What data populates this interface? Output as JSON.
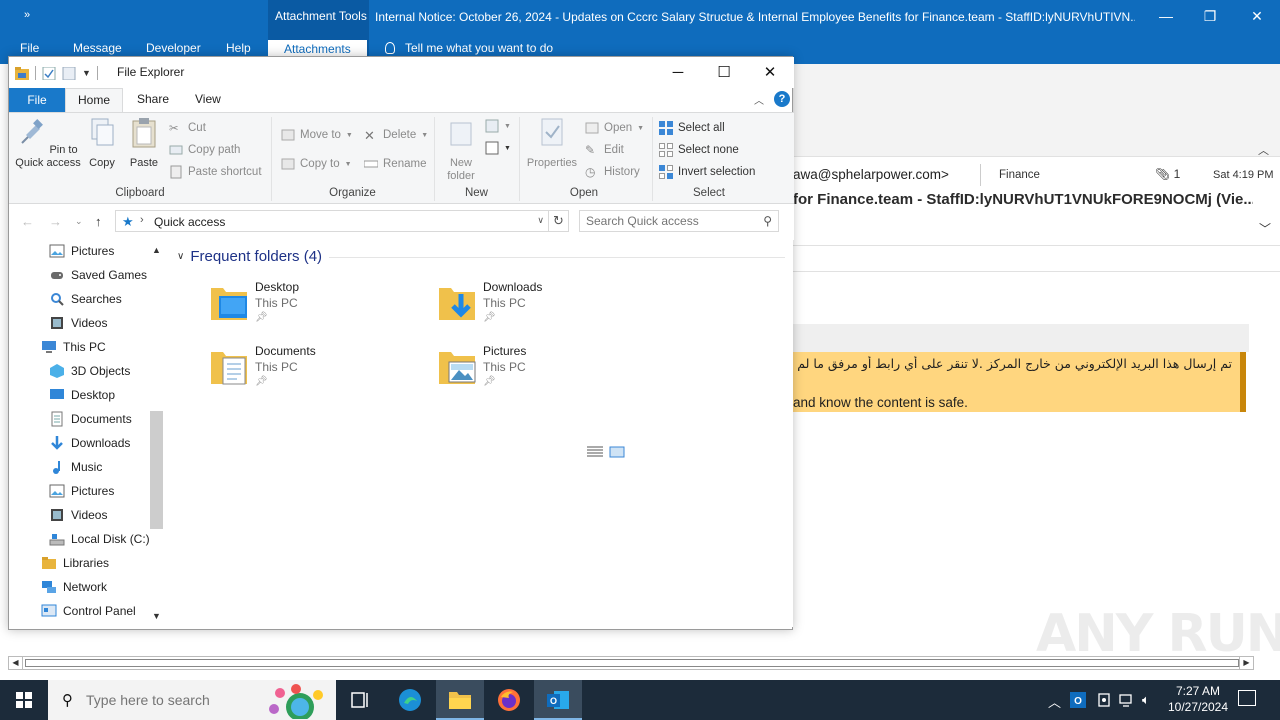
{
  "outlook": {
    "qat_symbol": "»",
    "context_tab_group": "Attachment Tools",
    "title": "Internal Notice: October 26, 2024 - Updates on Cccrc Salary Structue & Internal Employee Benefits for Finance.team - StaffID:lyNURVhUTIVN...",
    "tabs": [
      "File",
      "Message",
      "Developer",
      "Help",
      "Attachments"
    ],
    "tell_me": "Tell me what you want to do",
    "from": "awa@sphelarpower.com>",
    "to": "Finance",
    "attachment_count": "1",
    "date": "Sat 4:19 PM",
    "subject": "for Finance.team - StaffID:lyNURVhUT1VNUkFORE9NOCMj (Vie...",
    "warning_arabic": "تم إرسال هذا البريد الإلكتروني من خارج المركز .لا تنقر على أي رابط أو مرفق ما لم تتأكد من هوية المرسل",
    "warning_english": "and know the content is safe.",
    "warning_color": "#ffd67f",
    "accent": "#0f6cbd"
  },
  "explorer": {
    "title": "File Explorer",
    "tabs": {
      "file": "File",
      "home": "Home",
      "share": "Share",
      "view": "View"
    },
    "ribbon": {
      "clipboard": {
        "label": "Clipboard",
        "pin": "Pin to Quick access",
        "copy": "Copy",
        "paste": "Paste",
        "cut": "Cut",
        "copy_path": "Copy path",
        "paste_shortcut": "Paste shortcut"
      },
      "organize": {
        "label": "Organize",
        "move_to": "Move to",
        "copy_to": "Copy to",
        "delete": "Delete",
        "rename": "Rename"
      },
      "new": {
        "label": "New",
        "new_folder": "New folder"
      },
      "open": {
        "label": "Open",
        "properties": "Properties",
        "open": "Open",
        "edit": "Edit",
        "history": "History"
      },
      "select": {
        "label": "Select",
        "select_all": "Select all",
        "select_none": "Select none",
        "invert": "Invert selection"
      }
    },
    "address": {
      "path": "Quick access",
      "search_placeholder": "Search Quick access"
    },
    "nav_items": [
      {
        "label": "Pictures",
        "icon": "pictures-icon"
      },
      {
        "label": "Saved Games",
        "icon": "saved-games-icon"
      },
      {
        "label": "Searches",
        "icon": "searches-icon"
      },
      {
        "label": "Videos",
        "icon": "videos-icon"
      },
      {
        "label": "This PC",
        "icon": "this-pc-icon"
      },
      {
        "label": "3D Objects",
        "icon": "3d-objects-icon"
      },
      {
        "label": "Desktop",
        "icon": "desktop-icon"
      },
      {
        "label": "Documents",
        "icon": "documents-icon"
      },
      {
        "label": "Downloads",
        "icon": "downloads-icon"
      },
      {
        "label": "Music",
        "icon": "music-icon"
      },
      {
        "label": "Pictures",
        "icon": "pictures-icon"
      },
      {
        "label": "Videos",
        "icon": "videos-icon"
      },
      {
        "label": "Local Disk (C:)",
        "icon": "disk-icon"
      },
      {
        "label": "Libraries",
        "icon": "libraries-icon"
      },
      {
        "label": "Network",
        "icon": "network-icon"
      },
      {
        "label": "Control Panel",
        "icon": "control-panel-icon"
      }
    ],
    "section_title": "Frequent folders (4)",
    "folders": [
      {
        "name": "Desktop",
        "location": "This PC"
      },
      {
        "name": "Downloads",
        "location": "This PC"
      },
      {
        "name": "Documents",
        "location": "This PC"
      },
      {
        "name": "Pictures",
        "location": "This PC"
      }
    ]
  },
  "taskbar": {
    "search_placeholder": "Type here to search",
    "time": "7:27 AM",
    "date": "10/27/2024"
  },
  "watermark": "ANY RUN"
}
